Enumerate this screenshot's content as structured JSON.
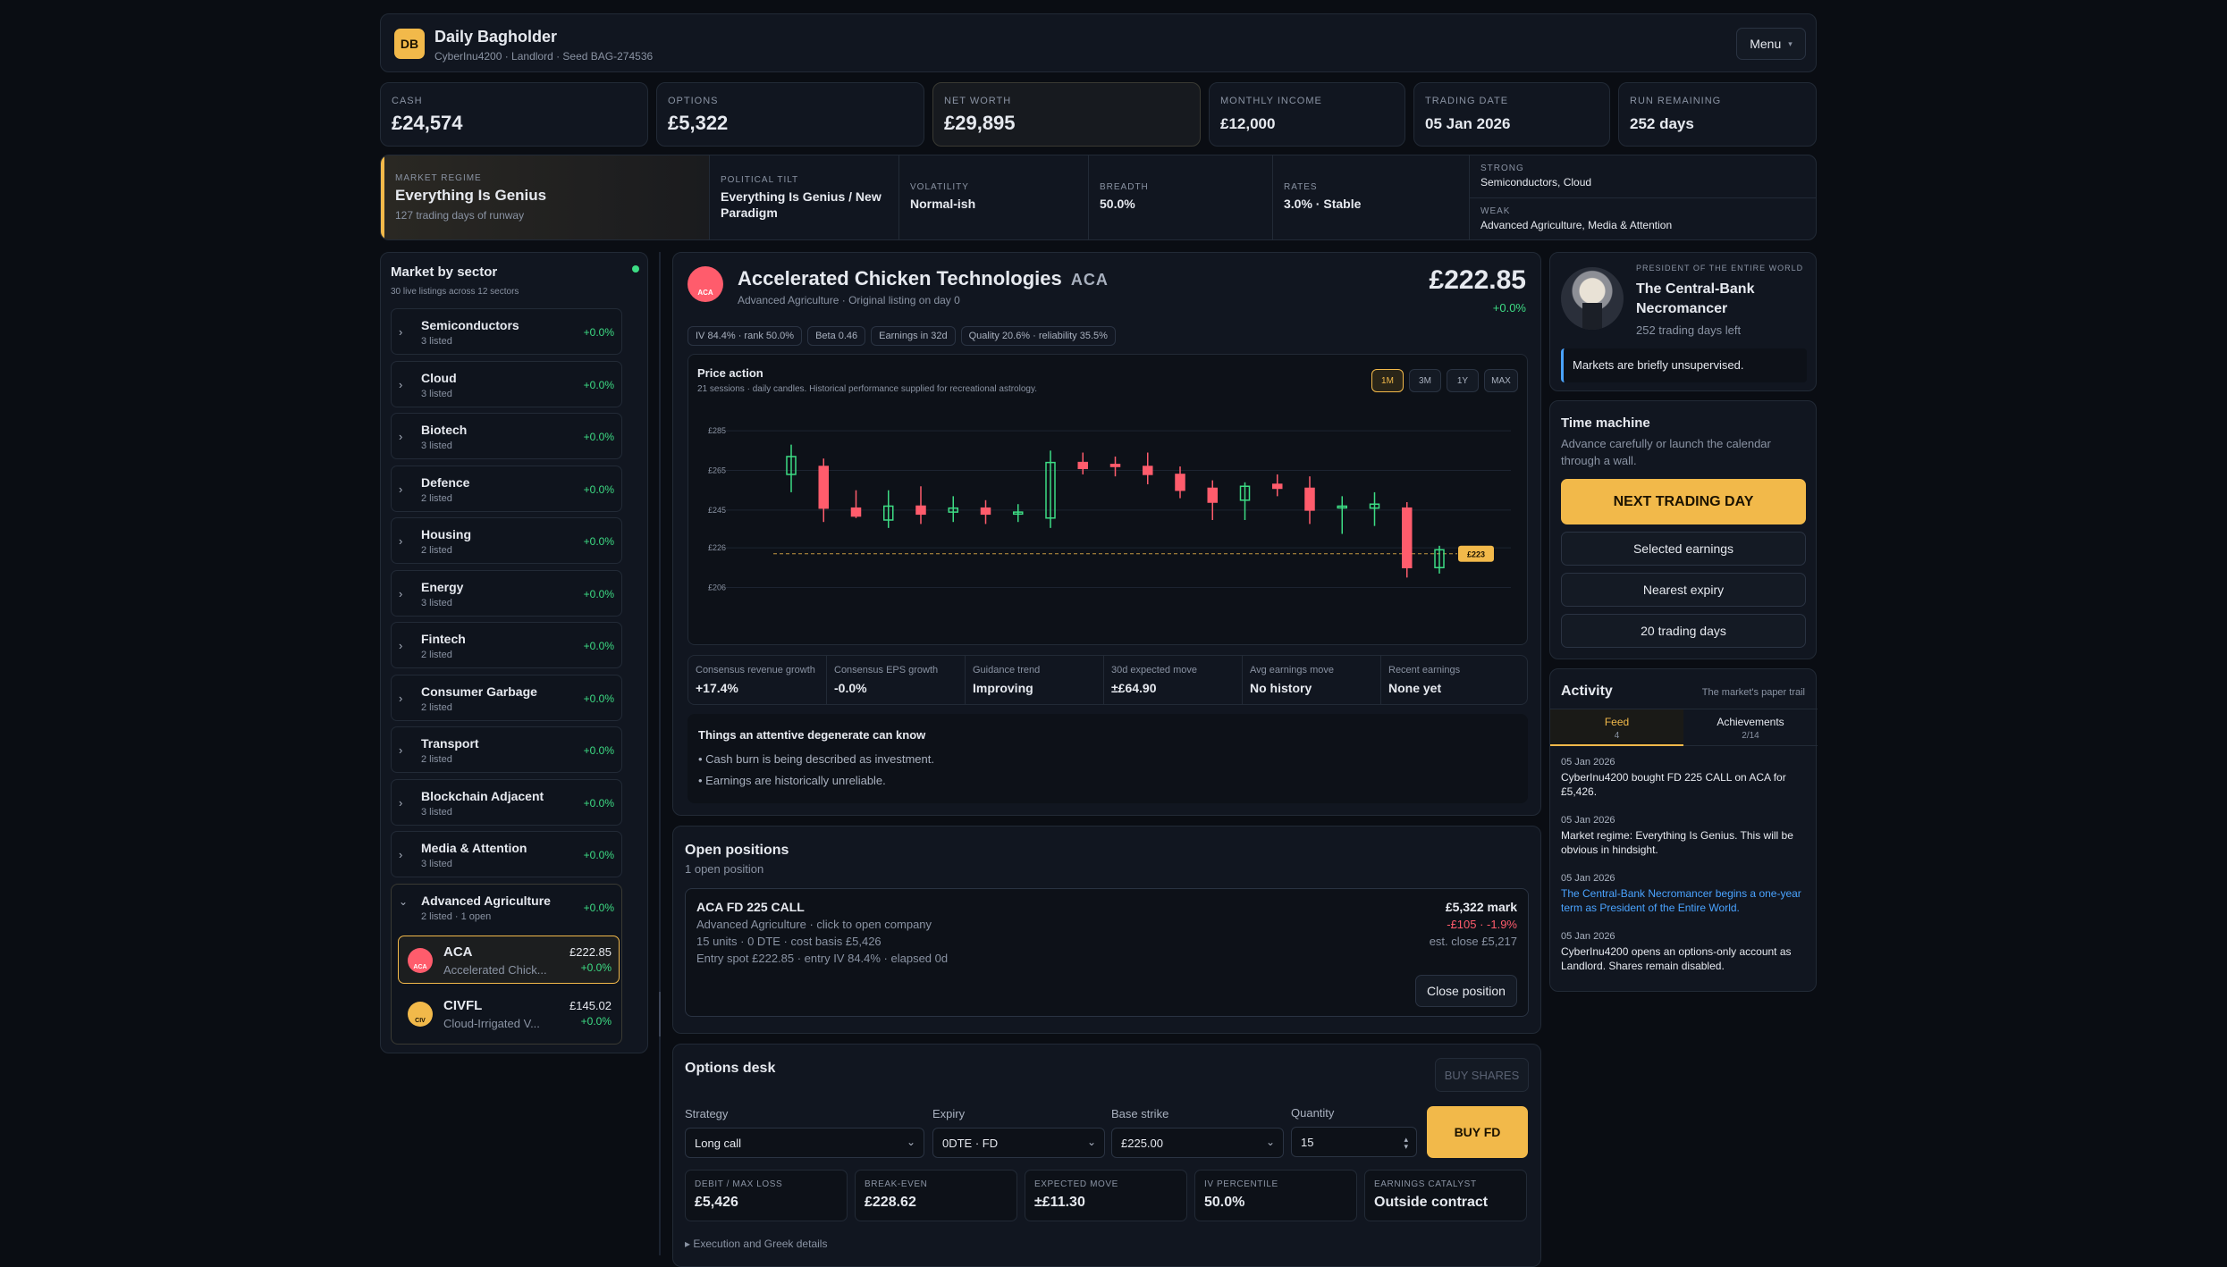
{
  "app": {
    "logo": "DB",
    "title": "Daily Bagholder",
    "subtitle": "CyberInu4200 · Landlord · Seed BAG-274536",
    "menu_label": "Menu"
  },
  "stats": [
    {
      "label": "CASH",
      "value": "£24,574"
    },
    {
      "label": "OPTIONS",
      "value": "£5,322"
    },
    {
      "label": "NET WORTH",
      "value": "£29,895"
    },
    {
      "label": "MONTHLY INCOME",
      "value": "£12,000"
    },
    {
      "label": "TRADING DATE",
      "value": "05 Jan 2026"
    },
    {
      "label": "RUN REMAINING",
      "value": "252 days"
    }
  ],
  "regime": {
    "label": "MARKET REGIME",
    "name": "Everything Is Genius",
    "runway": "127 trading days of runway",
    "political_label": "POLITICAL TILT",
    "political": "Everything Is Genius / New Paradigm",
    "volatility_label": "VOLATILITY",
    "volatility": "Normal-ish",
    "breadth_label": "BREADTH",
    "breadth": "50.0%",
    "rates_label": "RATES",
    "rates": "3.0% · Stable",
    "strong_label": "STRONG",
    "strong": "Semiconductors, Cloud",
    "weak_label": "WEAK",
    "weak": "Advanced Agriculture, Media & Attention"
  },
  "sectors_panel": {
    "title": "Market by sector",
    "subtitle": "30 live listings across 12 sectors",
    "sectors": [
      {
        "name": "Semiconductors",
        "count": "3 listed",
        "change": "+0.0%"
      },
      {
        "name": "Cloud",
        "count": "3 listed",
        "change": "+0.0%"
      },
      {
        "name": "Biotech",
        "count": "3 listed",
        "change": "+0.0%"
      },
      {
        "name": "Defence",
        "count": "2 listed",
        "change": "+0.0%"
      },
      {
        "name": "Housing",
        "count": "2 listed",
        "change": "+0.0%"
      },
      {
        "name": "Energy",
        "count": "3 listed",
        "change": "+0.0%"
      },
      {
        "name": "Fintech",
        "count": "2 listed",
        "change": "+0.0%"
      },
      {
        "name": "Consumer Garbage",
        "count": "2 listed",
        "change": "+0.0%"
      },
      {
        "name": "Transport",
        "count": "2 listed",
        "change": "+0.0%"
      },
      {
        "name": "Blockchain Adjacent",
        "count": "3 listed",
        "change": "+0.0%"
      },
      {
        "name": "Media & Attention",
        "count": "3 listed",
        "change": "+0.0%"
      }
    ],
    "expanded": {
      "name": "Advanced Agriculture",
      "count": "2 listed · 1 open",
      "change": "+0.0%"
    },
    "tickers": [
      {
        "symbol": "ACA",
        "name": "Accelerated Chick...",
        "price": "£222.85",
        "change": "+0.0%",
        "icon_text": "ACA"
      },
      {
        "symbol": "CIVFL",
        "name": "Cloud-Irrigated V...",
        "price": "£145.02",
        "change": "+0.0%",
        "icon_text": "CIV"
      }
    ]
  },
  "company": {
    "name": "Accelerated Chicken Technologies",
    "ticker": "ACA",
    "icon_text": "ACA",
    "subtitle": "Advanced Agriculture · Original listing on day 0",
    "price": "£222.85",
    "change": "+0.0%",
    "pills": [
      "IV 84.4% · rank 50.0%",
      "Beta 0.46",
      "Earnings in 32d",
      "Quality 20.6% · reliability 35.5%"
    ],
    "chart_title": "Price action",
    "chart_subtitle": "21 sessions · daily candles. Historical performance supplied for recreational astrology.",
    "timeframes": [
      "1M",
      "3M",
      "1Y",
      "MAX"
    ],
    "metrics": [
      {
        "label": "Consensus revenue growth",
        "value": "+17.4%"
      },
      {
        "label": "Consensus EPS growth",
        "value": "-0.0%"
      },
      {
        "label": "Guidance trend",
        "value": "Improving"
      },
      {
        "label": "30d expected move",
        "value": "±£64.90"
      },
      {
        "label": "Avg earnings move",
        "value": "No history"
      },
      {
        "label": "Recent earnings",
        "value": "None yet"
      }
    ],
    "notes_title": "Things an attentive degenerate can know",
    "notes": [
      "Cash burn is being described as investment.",
      "Earnings are historically unreliable."
    ]
  },
  "chart_data": {
    "type": "candlestick",
    "y_ticks": [
      "£285",
      "£265",
      "£245",
      "£226",
      "£206"
    ],
    "ylim": [
      199,
      290
    ],
    "last_price_label": "£223",
    "last_price": 223,
    "candles": [
      {
        "o": 263,
        "h": 278,
        "l": 254,
        "c": 272
      },
      {
        "o": 267,
        "h": 271,
        "l": 239,
        "c": 246
      },
      {
        "o": 246,
        "h": 255,
        "l": 241,
        "c": 242
      },
      {
        "o": 240,
        "h": 255,
        "l": 236,
        "c": 247
      },
      {
        "o": 247,
        "h": 257,
        "l": 238,
        "c": 243
      },
      {
        "o": 244,
        "h": 252,
        "l": 239,
        "c": 246
      },
      {
        "o": 246,
        "h": 250,
        "l": 238,
        "c": 243
      },
      {
        "o": 243,
        "h": 248,
        "l": 239,
        "c": 244
      },
      {
        "o": 241,
        "h": 275,
        "l": 236,
        "c": 269
      },
      {
        "o": 269,
        "h": 274,
        "l": 263,
        "c": 266
      },
      {
        "o": 268,
        "h": 272,
        "l": 262,
        "c": 267
      },
      {
        "o": 267,
        "h": 274,
        "l": 258,
        "c": 263
      },
      {
        "o": 263,
        "h": 267,
        "l": 251,
        "c": 255
      },
      {
        "o": 256,
        "h": 260,
        "l": 240,
        "c": 249
      },
      {
        "o": 250,
        "h": 259,
        "l": 240,
        "c": 257
      },
      {
        "o": 258,
        "h": 263,
        "l": 252,
        "c": 256
      },
      {
        "o": 256,
        "h": 262,
        "l": 238,
        "c": 245
      },
      {
        "o": 247,
        "h": 252,
        "l": 233,
        "c": 247
      },
      {
        "o": 246,
        "h": 254,
        "l": 237,
        "c": 248
      },
      {
        "o": 246,
        "h": 249,
        "l": 211,
        "c": 216
      },
      {
        "o": 216,
        "h": 227,
        "l": 213,
        "c": 225
      }
    ]
  },
  "positions": {
    "title": "Open positions",
    "subtitle": "1 open position",
    "items": [
      {
        "name": "ACA FD 225 CALL",
        "line1": "Advanced Agriculture · click to open company",
        "line2": "15 units · 0 DTE · cost basis £5,426",
        "line3": "Entry spot £222.85 · entry IV 84.4% · elapsed 0d",
        "mark": "£5,322 mark",
        "pnl": "-£105 · -1.9%",
        "close_est": "est. close £5,217",
        "close_label": "Close position"
      }
    ]
  },
  "desk": {
    "title": "Options desk",
    "buy_shares_label": "BUY SHARES",
    "strategy_label": "Strategy",
    "strategy": "Long call",
    "expiry_label": "Expiry",
    "expiry": "0DTE · FD",
    "strike_label": "Base strike",
    "strike": "£225.00",
    "quantity_label": "Quantity",
    "quantity": "15",
    "buy_label": "BUY FD",
    "stats": [
      {
        "label": "DEBIT / MAX LOSS",
        "value": "£5,426"
      },
      {
        "label": "BREAK-EVEN",
        "value": "£228.62"
      },
      {
        "label": "EXPECTED MOVE",
        "value": "±£11.30"
      },
      {
        "label": "IV PERCENTILE",
        "value": "50.0%"
      },
      {
        "label": "EARNINGS CATALYST",
        "value": "Outside contract"
      }
    ],
    "details_label": "▸ Execution and Greek details"
  },
  "president": {
    "label": "PRESIDENT OF THE ENTIRE WORLD",
    "name": "The Central-Bank Necromancer",
    "days": "252 trading days left",
    "quote": "Markets are briefly unsupervised."
  },
  "time_machine": {
    "title": "Time machine",
    "subtitle": "Advance carefully or launch the calendar through a wall.",
    "next_label": "NEXT TRADING DAY",
    "buttons": [
      "Selected earnings",
      "Nearest expiry",
      "20 trading days"
    ]
  },
  "activity": {
    "title": "Activity",
    "tagline": "The market's paper trail",
    "tabs": [
      {
        "label": "Feed",
        "count": "4"
      },
      {
        "label": "Achievements",
        "count": "2/14"
      }
    ],
    "items": [
      {
        "date": "05 Jan 2026",
        "text": "CyberInu4200 bought FD 225 CALL on ACA for £5,426."
      },
      {
        "date": "05 Jan 2026",
        "text": "Market regime: Everything Is Genius. This will be obvious in hindsight."
      },
      {
        "date": "05 Jan 2026",
        "text": "The Central-Bank Necromancer begins a one-year term as President of the Entire World."
      },
      {
        "date": "05 Jan 2026",
        "text": "CyberInu4200 opens an options-only account as Landlord. Shares remain disabled."
      }
    ]
  },
  "colors": {
    "accent": "#f2b94a",
    "up": "#3ddc84",
    "down": "#ff5c6c",
    "bg": "#0a0d13",
    "panel": "#111620"
  }
}
